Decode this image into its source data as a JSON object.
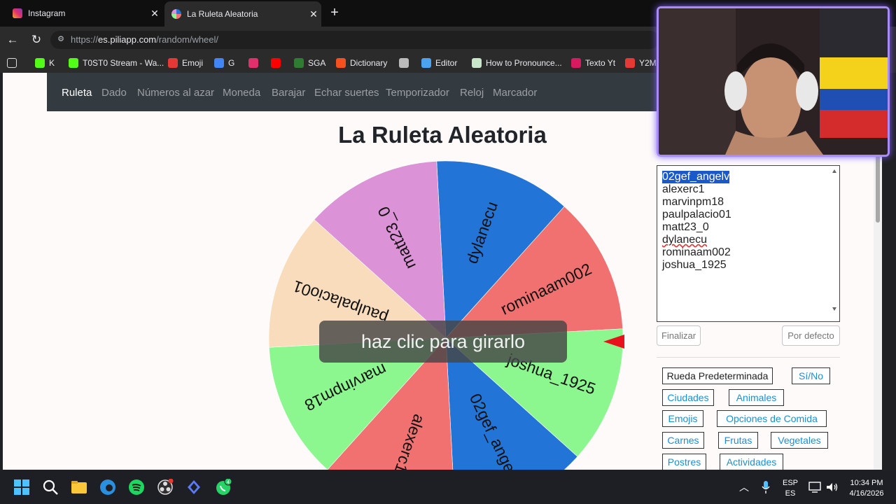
{
  "browser": {
    "tabs": [
      {
        "title": "Instagram",
        "icon": "instagram-icon",
        "active": false
      },
      {
        "title": "La Ruleta Aleatoria",
        "icon": "piliapp-icon",
        "active": true
      }
    ],
    "url_prefix": "https://",
    "url_host": "es.piliapp.com",
    "url_path": "/random/wheel/",
    "bookmarks": [
      {
        "label": "K",
        "icon": "kick-icon",
        "color": "#53fc18"
      },
      {
        "label": "T0ST0 Stream - Wa...",
        "icon": "kick-icon",
        "color": "#53fc18"
      },
      {
        "label": "Emoji",
        "icon": "lightning-icon",
        "color": "#e53935"
      },
      {
        "label": "G",
        "icon": "google-icon",
        "color": "#4285f4"
      },
      {
        "label": "",
        "icon": "instagram-icon",
        "color": "#e1306c"
      },
      {
        "label": "",
        "icon": "youtube-icon",
        "color": "#ff0000"
      },
      {
        "label": "SGA",
        "icon": "sga-icon",
        "color": "#2e7d32"
      },
      {
        "label": "Dictionary",
        "icon": "dictionary-icon",
        "color": "#f4511e"
      },
      {
        "label": "",
        "icon": "openai-icon",
        "color": "#bbbbbb"
      },
      {
        "label": "Editor",
        "icon": "editor-icon",
        "color": "#4aa3f0"
      },
      {
        "label": "How to Pronounce...",
        "icon": "pronounce-icon",
        "color": "#c8e6c9"
      },
      {
        "label": "Texto Yt",
        "icon": "texto-icon",
        "color": "#d81b60"
      },
      {
        "label": "Y2M",
        "icon": "y2m-icon",
        "color": "#e53935"
      }
    ]
  },
  "site": {
    "nav": [
      "Ruleta",
      "Dado",
      "Números al azar",
      "Moneda",
      "Barajar",
      "Echar suertes",
      "Temporizador",
      "Reloj",
      "Marcador"
    ],
    "active_nav": "Ruleta",
    "title": "La Ruleta Aleatoria",
    "spin_hint": "haz clic para girarlo"
  },
  "wheel": {
    "segments": [
      {
        "label": "dylanecu",
        "color": "#2275d7"
      },
      {
        "label": "rominaam002",
        "color": "#f17171"
      },
      {
        "label": "joshua_1925",
        "color": "#8cf78f"
      },
      {
        "label": "02gef_angelv",
        "color": "#2275d7"
      },
      {
        "label": "alexerc1",
        "color": "#f17171"
      },
      {
        "label": "marvinpm18",
        "color": "#8cf78f"
      },
      {
        "label": "paulpalacio01",
        "color": "#f8dcbb"
      },
      {
        "label": "matt23_0",
        "color": "#dc92d6"
      }
    ],
    "pointer_color": "#e8121c"
  },
  "editor": {
    "entries": [
      "02gef_angelv",
      "alexerc1",
      "marvinpm18",
      "paulpalacio01",
      "matt23_0",
      "dylanecu",
      "rominaam002",
      "joshua_1925"
    ],
    "selected": "02gef_angelv",
    "spellcheck_flagged": "dylanecu",
    "finalizar": "Finalizar",
    "por_defecto": "Por defecto"
  },
  "presets": [
    "Rueda Predeterminada",
    "Sí/No",
    "Ciudades",
    "Animales",
    "Emojis",
    "Opciones de Comida",
    "Carnes",
    "Frutas",
    "Vegetales",
    "Postres",
    "Actividades"
  ],
  "taskbar": {
    "apps": [
      "start-icon",
      "search-icon",
      "file-explorer-icon",
      "edge-icon",
      "spotify-icon",
      "obs-icon",
      "app-icon",
      "whatsapp-icon"
    ],
    "whatsapp_badge": "4",
    "lang_top": "ESP",
    "lang_bottom": "ES",
    "time": "10:34 PM",
    "date": "4/16/2026"
  }
}
